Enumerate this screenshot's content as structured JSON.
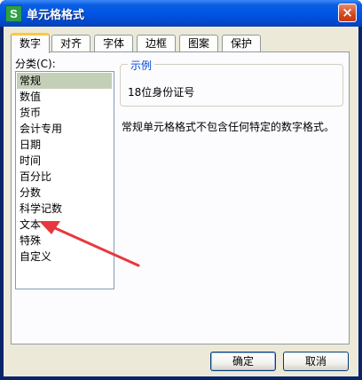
{
  "window": {
    "title": "单元格格式",
    "app_icon_glyph": "S",
    "close_glyph": "×"
  },
  "tabs": [
    {
      "label": "数字",
      "active": true
    },
    {
      "label": "对齐"
    },
    {
      "label": "字体"
    },
    {
      "label": "边框"
    },
    {
      "label": "图案"
    },
    {
      "label": "保护"
    }
  ],
  "category": {
    "label": "分类(C):",
    "items": [
      "常规",
      "数值",
      "货币",
      "会计专用",
      "日期",
      "时间",
      "百分比",
      "分数",
      "科学记数",
      "文本",
      "特殊",
      "自定义"
    ],
    "selected_index": 0
  },
  "sample": {
    "legend": "示例",
    "value": "18位身份证号"
  },
  "description": "常规单元格格式不包含任何特定的数字格式。",
  "buttons": {
    "ok": "确定",
    "cancel": "取消"
  },
  "colors": {
    "annotation_arrow": "#e8383d",
    "selection": "#c3cfb7",
    "titlebar": "#0055e5"
  }
}
